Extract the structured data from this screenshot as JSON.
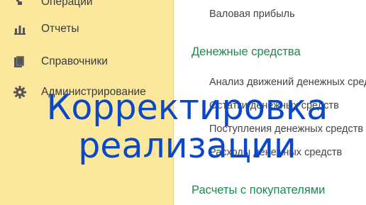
{
  "sidebar": {
    "items": [
      {
        "label": "Операции",
        "icon": "operations-icon"
      },
      {
        "label": "Отчеты",
        "icon": "bar-chart-icon"
      },
      {
        "label": "Справочники",
        "icon": "books-icon"
      },
      {
        "label": "Администрирование",
        "icon": "gear-icon"
      }
    ]
  },
  "content": {
    "top_link": "Валовая прибыль",
    "sections": [
      {
        "title": "Денежные средства",
        "links": [
          "Анализ движений денежных средств",
          "Остатки денежных средств",
          "Поступления денежных средств",
          "Расходы денежных средств"
        ]
      },
      {
        "title": "Расчеты с покупателями",
        "links": []
      }
    ]
  },
  "overlay": {
    "line1": "Корректировка",
    "line2": "реализации"
  },
  "colors": {
    "sidebar_bg": "#fbe89d",
    "section_title": "#1b8a4c",
    "overlay_text": "#0a47c9"
  }
}
